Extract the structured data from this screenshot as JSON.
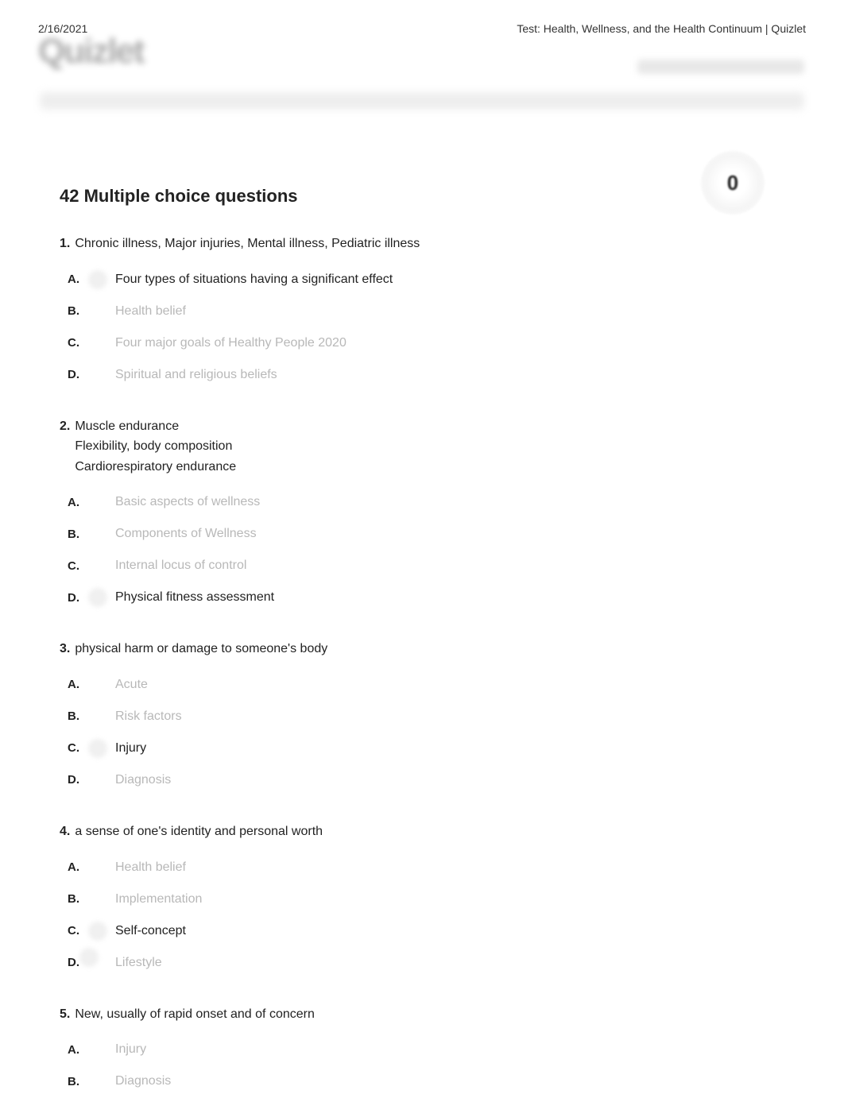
{
  "header": {
    "date": "2/16/2021",
    "title": "Test: Health, Wellness, and the Health Continuum | Quizlet"
  },
  "logo": "Quizlet",
  "badge": "0",
  "section_title": "42 Multiple choice questions",
  "questions": [
    {
      "number": "1.",
      "text": "Chronic illness, Major injuries, Mental illness, Pediatric illness",
      "options": [
        {
          "letter": "A.",
          "text": "Four types of situations having a significant effect",
          "active": true,
          "marker": true
        },
        {
          "letter": "B.",
          "text": "Health belief",
          "active": false,
          "marker": false
        },
        {
          "letter": "C.",
          "text": "Four major goals of Healthy People 2020",
          "active": false,
          "marker": false
        },
        {
          "letter": "D.",
          "text": "Spiritual and religious beliefs",
          "active": false,
          "marker": false
        }
      ]
    },
    {
      "number": "2.",
      "text": "Muscle endurance\nFlexibility, body composition\nCardiorespiratory endurance",
      "options": [
        {
          "letter": "A.",
          "text": "Basic aspects of wellness",
          "active": false,
          "marker": false
        },
        {
          "letter": "B.",
          "text": "Components of Wellness",
          "active": false,
          "marker": false
        },
        {
          "letter": "C.",
          "text": "Internal locus of control",
          "active": false,
          "marker": false
        },
        {
          "letter": "D.",
          "text": "Physical fitness assessment",
          "active": true,
          "marker": true
        }
      ]
    },
    {
      "number": "3.",
      "text": "physical harm or damage to someone's body",
      "options": [
        {
          "letter": "A.",
          "text": "Acute",
          "active": false,
          "marker": false
        },
        {
          "letter": "B.",
          "text": "Risk factors",
          "active": false,
          "marker": false
        },
        {
          "letter": "C.",
          "text": "Injury",
          "active": true,
          "marker": true
        },
        {
          "letter": "D.",
          "text": "Diagnosis",
          "active": false,
          "marker": false
        }
      ]
    },
    {
      "number": "4.",
      "text": "a sense of one's identity and personal worth",
      "options": [
        {
          "letter": "A.",
          "text": "Health belief",
          "active": false,
          "marker": false
        },
        {
          "letter": "B.",
          "text": "Implementation",
          "active": false,
          "marker": false
        },
        {
          "letter": "C.",
          "text": "Self-concept",
          "active": true,
          "marker": true
        },
        {
          "letter": "D.",
          "text": "Lifestyle",
          "active": false,
          "marker": false
        }
      ]
    },
    {
      "number": "5.",
      "text": "New, usually of rapid onset and of concern",
      "options": [
        {
          "letter": "A.",
          "text": "Injury",
          "active": false,
          "marker": false
        },
        {
          "letter": "B.",
          "text": "Diagnosis",
          "active": false,
          "marker": false
        }
      ]
    }
  ]
}
